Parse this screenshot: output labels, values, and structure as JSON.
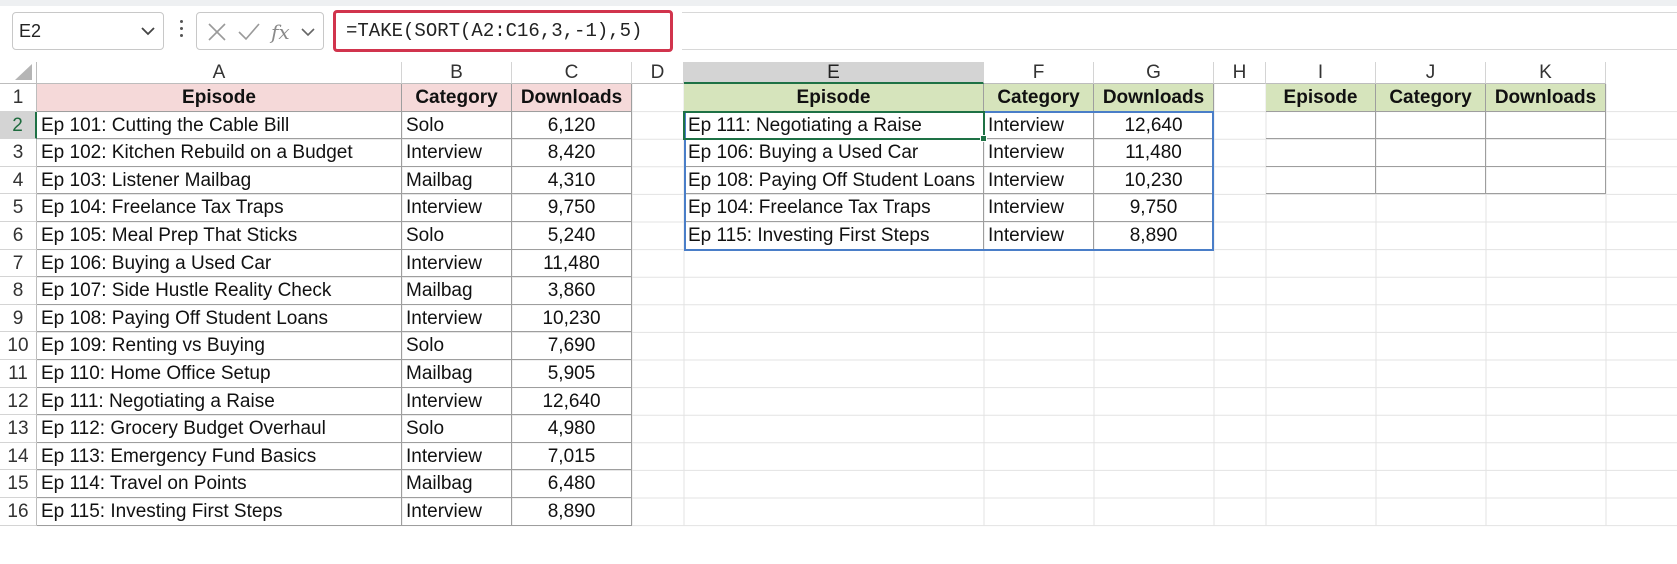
{
  "formula_bar": {
    "name_box": "E2",
    "formula": "=TAKE(SORT(A2:C16,3,-1),5)",
    "icons": [
      "chevron-down-icon",
      "more-vertical-icon",
      "cancel-icon",
      "enter-check-icon",
      "insert-function-icon"
    ]
  },
  "sheet": {
    "active_cell": "E2",
    "columns": [
      "A",
      "B",
      "C",
      "D",
      "E",
      "F",
      "G",
      "H",
      "I",
      "J",
      "K"
    ],
    "rows": [
      "1",
      "2",
      "3",
      "4",
      "5",
      "6",
      "7",
      "8",
      "9",
      "10",
      "11",
      "12",
      "13",
      "14",
      "15",
      "16"
    ]
  },
  "source_table": {
    "headers": [
      "Episode",
      "Category",
      "Downloads"
    ],
    "rows": [
      [
        "Ep 101: Cutting the Cable Bill",
        "Solo",
        "6,120"
      ],
      [
        "Ep 102: Kitchen Rebuild on a Budget",
        "Interview",
        "8,420"
      ],
      [
        "Ep 103: Listener Mailbag",
        "Mailbag",
        "4,310"
      ],
      [
        "Ep 104: Freelance Tax Traps",
        "Interview",
        "9,750"
      ],
      [
        "Ep 105: Meal Prep That Sticks",
        "Solo",
        "5,240"
      ],
      [
        "Ep 106: Buying a Used Car",
        "Interview",
        "11,480"
      ],
      [
        "Ep 107: Side Hustle Reality Check",
        "Mailbag",
        "3,860"
      ],
      [
        "Ep 108: Paying Off Student Loans",
        "Interview",
        "10,230"
      ],
      [
        "Ep 109: Renting vs Buying",
        "Solo",
        "7,690"
      ],
      [
        "Ep 110: Home Office Setup",
        "Mailbag",
        "5,905"
      ],
      [
        "Ep 111: Negotiating a Raise",
        "Interview",
        "12,640"
      ],
      [
        "Ep 112: Grocery Budget Overhaul",
        "Solo",
        "4,980"
      ],
      [
        "Ep 113: Emergency Fund Basics",
        "Interview",
        "7,015"
      ],
      [
        "Ep 114: Travel on Points",
        "Mailbag",
        "6,480"
      ],
      [
        "Ep 115: Investing First Steps",
        "Interview",
        "8,890"
      ]
    ]
  },
  "result_table": {
    "headers": [
      "Episode",
      "Category",
      "Downloads"
    ],
    "rows": [
      [
        "Ep 111: Negotiating a Raise",
        "Interview",
        "12,640"
      ],
      [
        "Ep 106: Buying a Used Car",
        "Interview",
        "11,480"
      ],
      [
        "Ep 108: Paying Off Student Loans",
        "Interview",
        "10,230"
      ],
      [
        "Ep 104: Freelance Tax Traps",
        "Interview",
        "9,750"
      ],
      [
        "Ep 115: Investing First Steps",
        "Interview",
        "8,890"
      ]
    ]
  },
  "empty_table": {
    "headers": [
      "Episode",
      "Category",
      "Downloads"
    ],
    "blank_rows": 3
  },
  "colors": {
    "source_header_fill": "#f5d9d9",
    "result_header_fill": "#d6e4bc",
    "formula_highlight": "#d1344d",
    "active_cell_border": "#1e7145",
    "spill_border": "#4a7ec8"
  }
}
